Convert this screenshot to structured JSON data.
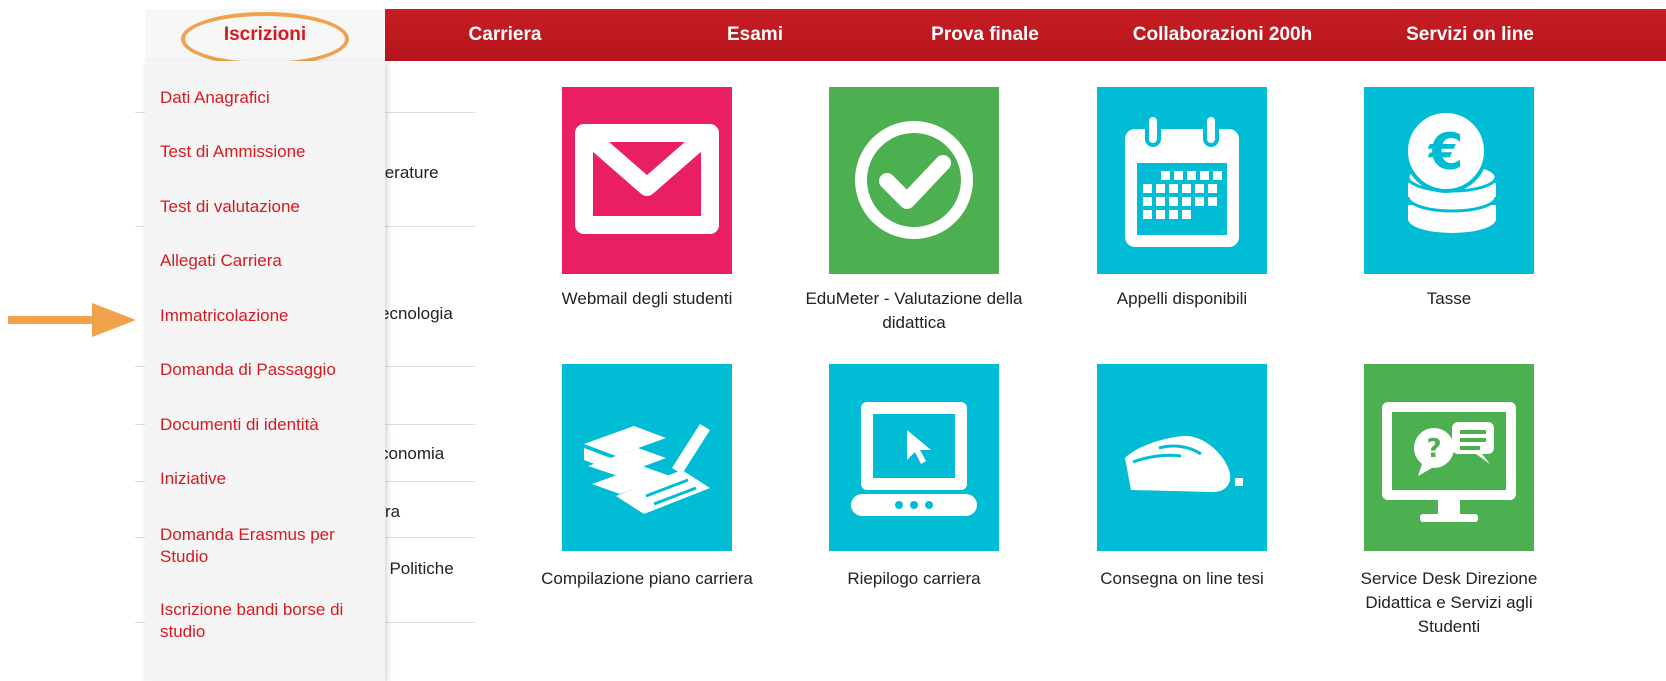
{
  "nav": {
    "items": [
      "Iscrizioni",
      "Carriera",
      "Esami",
      "Prova finale",
      "Collaborazioni 200h",
      "Servizi on line"
    ],
    "active_index": 0
  },
  "dropdown": {
    "items": [
      "Dati Anagrafici",
      "Test di Ammissione",
      "Test di valutazione",
      "Allegati Carriera",
      "Immatricolazione",
      "Domanda di Passaggio",
      "Documenti di identità",
      "Iniziative",
      "Domanda Erasmus per Studio",
      "Iscrizione bandi borse di studio"
    ]
  },
  "background_list": {
    "fragments": [
      "terature",
      "ecnologia",
      "conomia",
      "ra",
      ", Politiche"
    ]
  },
  "services": [
    {
      "label": "Webmail degli studenti",
      "icon": "envelope-icon",
      "color": "#e91e63"
    },
    {
      "label": "EduMeter - Valutazione della didattica",
      "icon": "checkmark-icon",
      "color": "#4caf50"
    },
    {
      "label": "Appelli disponibili",
      "icon": "calendar-icon",
      "color": "#00bcd4"
    },
    {
      "label": "Tasse",
      "icon": "euro-coins-icon",
      "color": "#00bcd4"
    },
    {
      "label": "Compilazione piano carriera",
      "icon": "books-pen-icon",
      "color": "#00bcd4"
    },
    {
      "label": "Riepilogo carriera",
      "icon": "laptop-cursor-icon",
      "color": "#00bcd4"
    },
    {
      "label": "Consegna on line tesi",
      "icon": "hand-mouse-icon",
      "color": "#00bcd4"
    },
    {
      "label": "Service Desk Direzione Didattica e Servizi agli Studenti",
      "icon": "helpdesk-monitor-icon",
      "color": "#4caf50"
    }
  ],
  "colors": {
    "nav_red": "#c81e24",
    "menu_link_red": "#d71920",
    "annotation_orange": "#f0a24a"
  }
}
